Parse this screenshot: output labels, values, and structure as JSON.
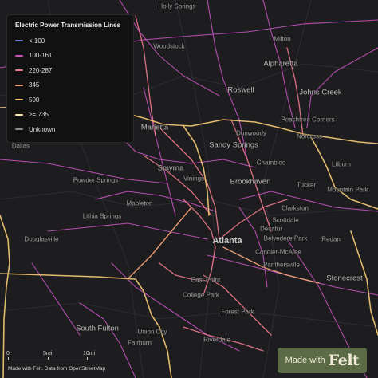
{
  "legend": {
    "title": "Electric Power Transmission Lines",
    "items": [
      {
        "label": "< 100",
        "color": "#6a6fd8"
      },
      {
        "label": "100-161",
        "color": "#c653c0"
      },
      {
        "label": "220-287",
        "color": "#f07a8c"
      },
      {
        "label": "345",
        "color": "#f6a77a"
      },
      {
        "label": "500",
        "color": "#f7cc78"
      },
      {
        "label": ">= 735",
        "color": "#fbe9a6"
      },
      {
        "label": "Unknown",
        "color": "#8a8a8a"
      }
    ]
  },
  "places": [
    {
      "name": "Holly Springs",
      "kind": "town"
    },
    {
      "name": "Woodstock",
      "kind": "town"
    },
    {
      "name": "Milton",
      "kind": "town"
    },
    {
      "name": "Alpharetta",
      "kind": "city"
    },
    {
      "name": "Roswell",
      "kind": "city"
    },
    {
      "name": "Johns Creek",
      "kind": "city"
    },
    {
      "name": "Peachtree Corners",
      "kind": "town"
    },
    {
      "name": "Norcross",
      "kind": "town"
    },
    {
      "name": "Marietta",
      "kind": "city"
    },
    {
      "name": "Dunwoody",
      "kind": "town"
    },
    {
      "name": "Sandy Springs",
      "kind": "city"
    },
    {
      "name": "Dallas",
      "kind": "town"
    },
    {
      "name": "Smyrna",
      "kind": "city"
    },
    {
      "name": "Chamblee",
      "kind": "town"
    },
    {
      "name": "Lilburn",
      "kind": "town"
    },
    {
      "name": "Powder Springs",
      "kind": "town"
    },
    {
      "name": "Vinings",
      "kind": "town"
    },
    {
      "name": "Brookhaven",
      "kind": "city"
    },
    {
      "name": "Tucker",
      "kind": "town"
    },
    {
      "name": "Mountain Park",
      "kind": "town"
    },
    {
      "name": "Mableton",
      "kind": "town"
    },
    {
      "name": "Clarkston",
      "kind": "town"
    },
    {
      "name": "Lithia Springs",
      "kind": "town"
    },
    {
      "name": "Scottdale",
      "kind": "town"
    },
    {
      "name": "Douglasville",
      "kind": "town"
    },
    {
      "name": "Decatur",
      "kind": "town"
    },
    {
      "name": "Atlanta",
      "kind": "major"
    },
    {
      "name": "Belvedere Park",
      "kind": "town"
    },
    {
      "name": "Redan",
      "kind": "town"
    },
    {
      "name": "Candler-McAfee",
      "kind": "town"
    },
    {
      "name": "Panthersville",
      "kind": "town"
    },
    {
      "name": "East Point",
      "kind": "town"
    },
    {
      "name": "Stonecrest",
      "kind": "city"
    },
    {
      "name": "College Park",
      "kind": "town"
    },
    {
      "name": "Forest Park",
      "kind": "town"
    },
    {
      "name": "South Fulton",
      "kind": "city"
    },
    {
      "name": "Union City",
      "kind": "town"
    },
    {
      "name": "Riverdale",
      "kind": "town"
    },
    {
      "name": "Fairburn",
      "kind": "town"
    }
  ],
  "scale": {
    "zero": "0",
    "mid": "5mi",
    "end": "10mi"
  },
  "attribution": "Made with Felt. Data from OpenStreetMap",
  "badge": {
    "made_with": "Made with",
    "brand": "Felt"
  }
}
